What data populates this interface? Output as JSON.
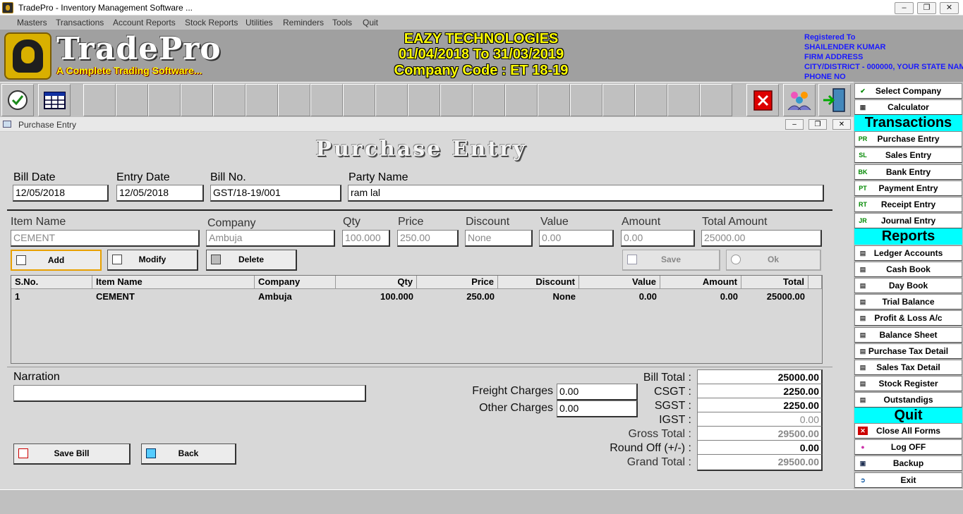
{
  "window": {
    "title": "TradePro - Inventory Management Software ..."
  },
  "menu": [
    "Masters",
    "Transactions",
    "Account Reports",
    "Stock Reports",
    "Utilities",
    "Reminders",
    "Tools",
    "Quit"
  ],
  "header": {
    "brand": "TradePro",
    "tagline": "A Complete Trading Software...",
    "company_name": "EAZY TECHNOLOGIES",
    "period": "01/04/2018 To 31/03/2019",
    "company_code": "Company Code : ET 18-19",
    "registered": [
      "Registered To",
      "SHAILENDER KUMAR",
      "FIRM ADDRESS",
      "CITY/DISTRICT - 000000, YOUR STATE NAM",
      "PHONE NO"
    ]
  },
  "sidebar": {
    "top": [
      {
        "label": "Select Company",
        "icon": "check-icon"
      },
      {
        "label": "Calculator",
        "icon": "calculator-icon"
      }
    ],
    "transactions_head": "Transactions",
    "transactions": [
      {
        "label": "Purchase Entry",
        "badge": "PR"
      },
      {
        "label": "Sales Entry",
        "badge": "SL"
      },
      {
        "label": "Bank Entry",
        "badge": "BK"
      },
      {
        "label": "Payment Entry",
        "badge": "PT"
      },
      {
        "label": "Receipt Entry",
        "badge": "RT"
      },
      {
        "label": "Journal Entry",
        "badge": "JR"
      }
    ],
    "reports_head": "Reports",
    "reports": [
      "Ledger Accounts",
      "Cash Book",
      "Day Book",
      "Trial Balance",
      "Profit & Loss A/c",
      "Balance Sheet",
      "Purchase Tax Detail",
      "Sales Tax Detail",
      "Stock Register",
      "Outstandigs"
    ],
    "quit_head": "Quit",
    "quit": [
      {
        "label": "Close All Forms",
        "icon": "close-icon"
      },
      {
        "label": "Log OFF",
        "icon": "users-icon"
      },
      {
        "label": "Backup",
        "icon": "floppy-icon"
      },
      {
        "label": "Exit",
        "icon": "exit-icon"
      }
    ]
  },
  "form": {
    "window_title": "Purchase Entry",
    "heading": "Purchase Entry",
    "bill_date": {
      "label": "Bill Date",
      "value": "12/05/2018"
    },
    "entry_date": {
      "label": "Entry Date",
      "value": "12/05/2018"
    },
    "bill_no": {
      "label": "Bill No.",
      "value": "GST/18-19/001"
    },
    "party_name": {
      "label": "Party Name",
      "value": "ram lal"
    },
    "item": {
      "item_name": {
        "label": "Item Name",
        "value": "CEMENT"
      },
      "company": {
        "label": "Company",
        "value": "Ambuja"
      },
      "qty": {
        "label": "Qty",
        "value": "100.000"
      },
      "price": {
        "label": "Price",
        "value": "250.00"
      },
      "discount": {
        "label": "Discount",
        "value": "None"
      },
      "value": {
        "label": "Value",
        "value": "0.00"
      },
      "amount": {
        "label": "Amount",
        "value": "0.00"
      },
      "total_amount": {
        "label": "Total Amount",
        "value": "25000.00"
      }
    },
    "buttons": {
      "add": "Add",
      "modify": "Modify",
      "delete": "Delete",
      "save": "Save",
      "ok": "Ok",
      "save_bill": "Save Bill",
      "back": "Back"
    },
    "grid": {
      "columns": [
        "S.No.",
        "Item Name",
        "Company",
        "Qty",
        "Price",
        "Discount",
        "Value",
        "Amount",
        "Total"
      ],
      "rows": [
        [
          "1",
          "CEMENT",
          "Ambuja",
          "100.000",
          "250.00",
          "None",
          "0.00",
          "0.00",
          "25000.00"
        ]
      ]
    },
    "narration": {
      "label": "Narration",
      "value": ""
    },
    "freight": {
      "label": "Freight Charges",
      "value": "0.00"
    },
    "other": {
      "label": "Other Charges",
      "value": "0.00"
    },
    "totals": [
      {
        "label": "Bill Total :",
        "value": "25000.00"
      },
      {
        "label": "CSGT :",
        "value": "2250.00"
      },
      {
        "label": "SGST :",
        "value": "2250.00"
      },
      {
        "label": "IGST :",
        "value": "0.00"
      },
      {
        "label": "Gross Total :",
        "value": "29500.00"
      },
      {
        "label": "Round Off (+/-) :",
        "value": "0.00"
      },
      {
        "label": "Grand Total :",
        "value": "29500.00"
      }
    ]
  }
}
